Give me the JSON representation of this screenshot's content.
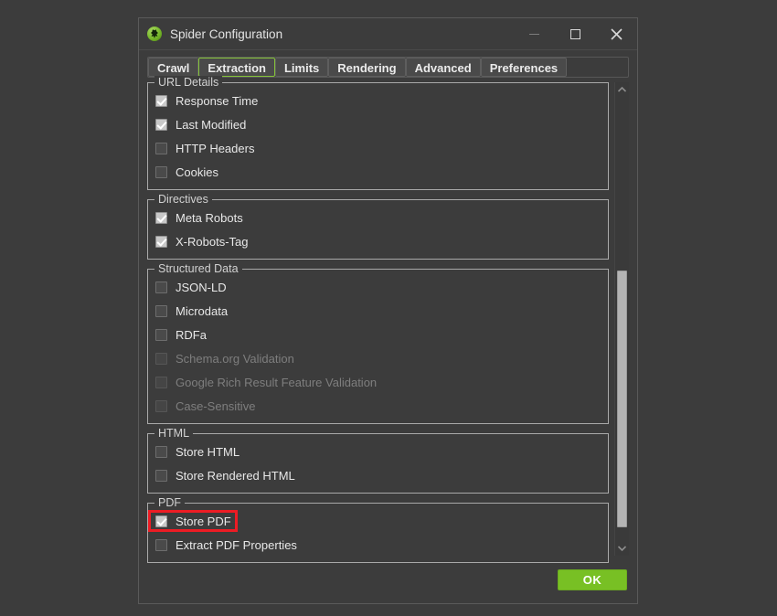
{
  "window": {
    "title": "Spider Configuration",
    "icon": "spider-logo-icon",
    "controls": {
      "minimize": "minimize-icon",
      "maximize": "maximize-icon",
      "close": "close-icon"
    }
  },
  "tabs": [
    {
      "label": "Crawl",
      "selected": false
    },
    {
      "label": "Extraction",
      "selected": true
    },
    {
      "label": "Limits",
      "selected": false
    },
    {
      "label": "Rendering",
      "selected": false
    },
    {
      "label": "Advanced",
      "selected": false
    },
    {
      "label": "Preferences",
      "selected": false
    }
  ],
  "groups": [
    {
      "title": "URL Details",
      "rows": [
        {
          "label": "Response Time",
          "checked": true,
          "disabled": false,
          "highlighted": false
        },
        {
          "label": "Last Modified",
          "checked": true,
          "disabled": false,
          "highlighted": false
        },
        {
          "label": "HTTP Headers",
          "checked": false,
          "disabled": false,
          "highlighted": false
        },
        {
          "label": "Cookies",
          "checked": false,
          "disabled": false,
          "highlighted": false
        }
      ]
    },
    {
      "title": "Directives",
      "rows": [
        {
          "label": "Meta Robots",
          "checked": true,
          "disabled": false,
          "highlighted": false
        },
        {
          "label": "X-Robots-Tag",
          "checked": true,
          "disabled": false,
          "highlighted": false
        }
      ]
    },
    {
      "title": "Structured Data",
      "rows": [
        {
          "label": "JSON-LD",
          "checked": false,
          "disabled": false,
          "highlighted": false
        },
        {
          "label": "Microdata",
          "checked": false,
          "disabled": false,
          "highlighted": false
        },
        {
          "label": "RDFa",
          "checked": false,
          "disabled": false,
          "highlighted": false
        },
        {
          "label": "Schema.org Validation",
          "checked": false,
          "disabled": true,
          "highlighted": false
        },
        {
          "label": "Google Rich Result Feature Validation",
          "checked": false,
          "disabled": true,
          "highlighted": false
        },
        {
          "label": "Case-Sensitive",
          "checked": false,
          "disabled": true,
          "highlighted": false
        }
      ]
    },
    {
      "title": "HTML",
      "rows": [
        {
          "label": "Store HTML",
          "checked": false,
          "disabled": false,
          "highlighted": false
        },
        {
          "label": "Store Rendered HTML",
          "checked": false,
          "disabled": false,
          "highlighted": false
        }
      ]
    },
    {
      "title": "PDF",
      "rows": [
        {
          "label": "Store PDF",
          "checked": true,
          "disabled": false,
          "highlighted": true
        },
        {
          "label": "Extract PDF Properties",
          "checked": false,
          "disabled": false,
          "highlighted": false
        }
      ]
    }
  ],
  "scrollbar": {
    "up_arrow": "chevron-up-icon",
    "down_arrow": "chevron-down-icon",
    "thumb_top_pct": 39,
    "thumb_height_pct": 58
  },
  "footer": {
    "ok_label": "OK"
  },
  "colors": {
    "accent_green": "#78c024",
    "selected_tab_border": "#85c33a",
    "highlight_red": "#ed1c24",
    "window_bg": "#3c3c3c",
    "desktop_bg": "#3c3c3c"
  }
}
